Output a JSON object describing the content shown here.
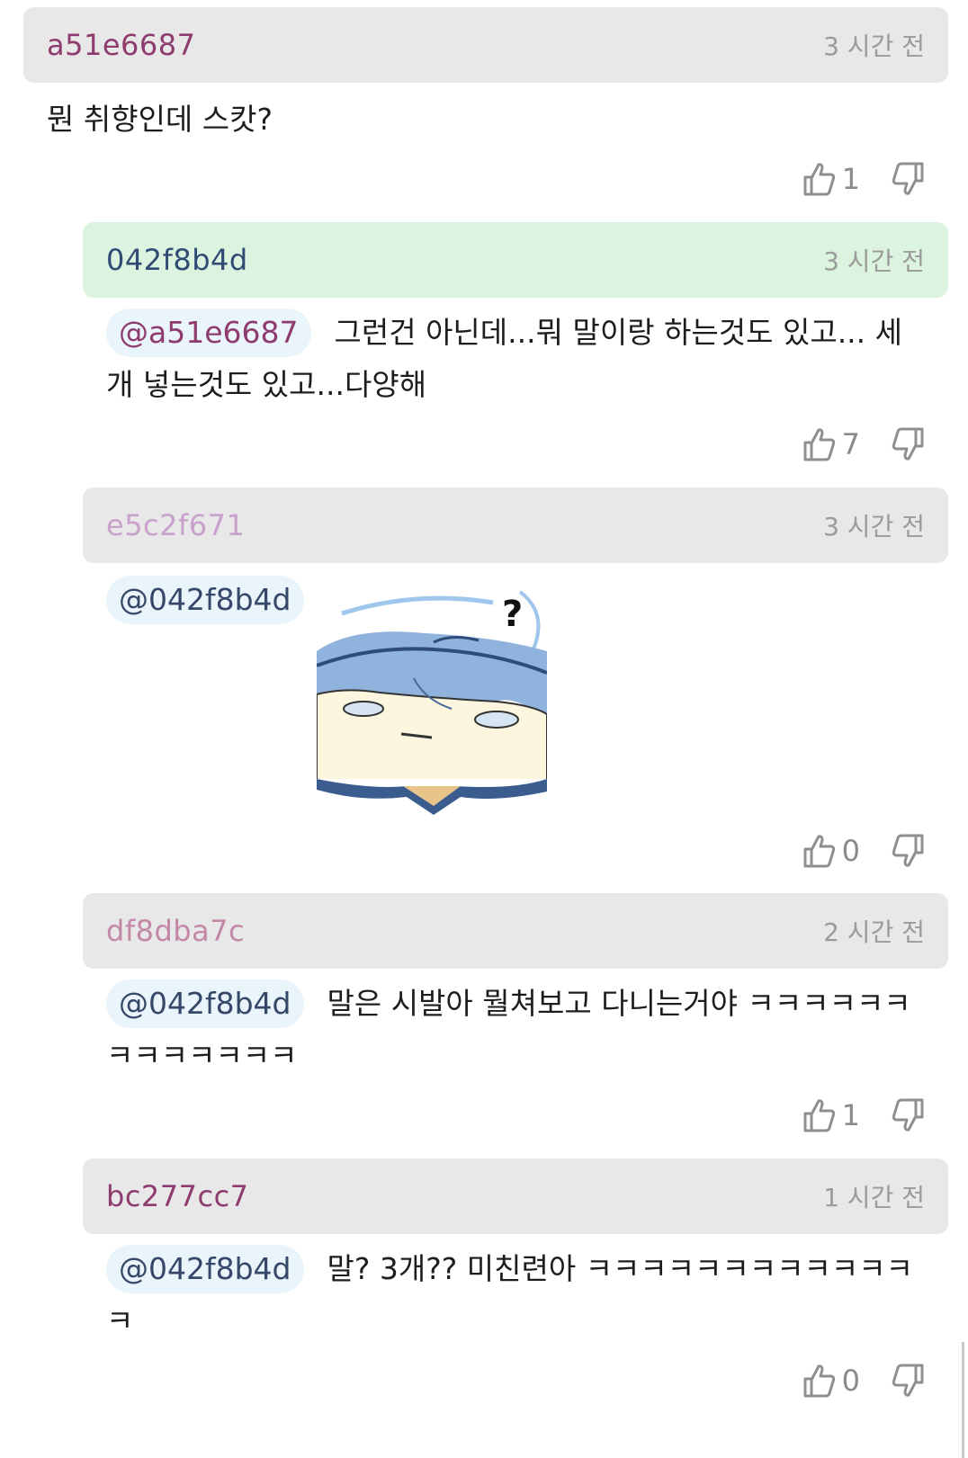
{
  "comments": [
    {
      "author": "a51e6687",
      "author_color": "#8e3b6e",
      "time": "3 시간 전",
      "text": "뭔 취향인데 스캇?",
      "likes": "1"
    },
    {
      "author": "042f8b4d",
      "author_color": "#2f4a73",
      "time": "3 시간 전",
      "highlighted": true,
      "mention": "@a51e6687",
      "mention_color": "#8e3b6e",
      "text_line1": "그런건 아닌데...뭐 말이랑 하는것도 있고... 세",
      "text_line2": "개 넣는것도 있고...다양해",
      "likes": "7"
    },
    {
      "author": "e5c2f671",
      "author_color": "#c8a1cc",
      "time": "3 시간 전",
      "mention": "@042f8b4d",
      "sticker": "confused-blue-haired-character-sticker",
      "likes": "0"
    },
    {
      "author": "df8dba7c",
      "author_color": "#c288a6",
      "time": "2 시간 전",
      "mention": "@042f8b4d",
      "text_line1": "말은 시발아 뭘쳐보고 다니는거야 ㅋㅋㅋㅋㅋㅋ",
      "text_line2": "ㅋㅋㅋㅋㅋㅋㅋ",
      "likes": "1"
    },
    {
      "author": "bc277cc7",
      "author_color": "#8e3b6e",
      "time": "1 시간 전",
      "mention": "@042f8b4d",
      "text_line1": "말? 3개?? 미친련아 ㅋㅋㅋㅋㅋㅋㅋㅋㅋㅋㅋㅋ",
      "text_line2": "ㅋ",
      "likes": "0"
    }
  ],
  "icons": {
    "like": "thumbs-up-icon",
    "dislike": "thumbs-down-icon"
  },
  "colors": {
    "header_bg": "#e8e8e8",
    "header_highlight_bg": "#dcf3df",
    "mention_bg": "#eaf4fb",
    "time_color": "#9b9b9b"
  }
}
